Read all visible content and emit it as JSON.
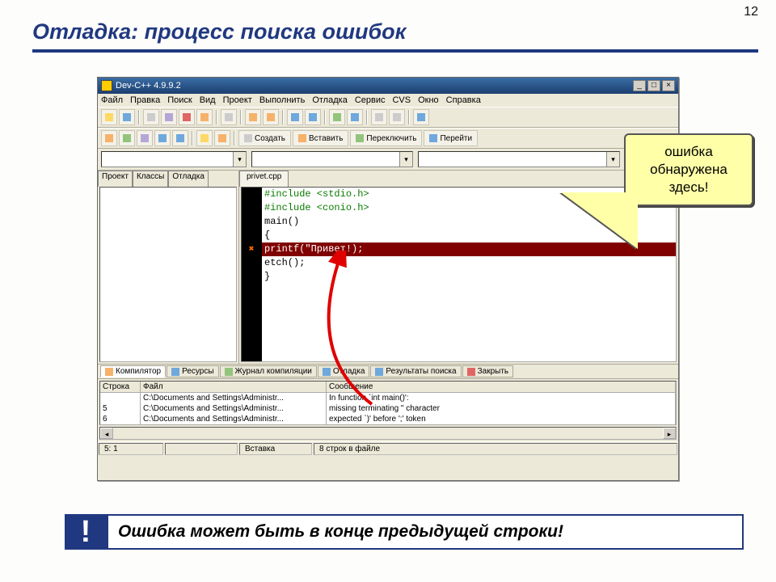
{
  "page_number": "12",
  "slide_title": "Отладка: процесс поиска ошибок",
  "window": {
    "title": "Dev-C++ 4.9.9.2",
    "window_controls": {
      "min": "_",
      "max": "□",
      "close": "×"
    }
  },
  "menu": [
    "Файл",
    "Правка",
    "Поиск",
    "Вид",
    "Проект",
    "Выполнить",
    "Отладка",
    "Сервис",
    "CVS",
    "Окно",
    "Справка"
  ],
  "toolbar2": {
    "create": "Создать",
    "insert": "Вставить",
    "switch": "Переключить",
    "goto": "Перейти"
  },
  "side_tabs": [
    "Проект",
    "Классы",
    "Отладка"
  ],
  "file_tab": "privet.cpp",
  "code": {
    "l1": "#include <stdio.h>",
    "l2": "#include <conio.h>",
    "l3": "main()",
    "l4": "{",
    "l5": "printf(\"Привет!);",
    "l6": "etch();",
    "l7": "}"
  },
  "bottom_tabs": {
    "compiler": "Компилятор",
    "resources": "Ресурсы",
    "log": "Журнал компиляции",
    "debug": "Отладка",
    "search": "Результаты поиска",
    "close": "Закрыть"
  },
  "error_table": {
    "headers": {
      "line": "Строка",
      "file": "Файл",
      "msg": "Сообщение"
    },
    "rows": [
      {
        "line": "",
        "file": "C:\\Documents and Settings\\Administr...",
        "msg": "In function `int main()':"
      },
      {
        "line": "5",
        "file": "C:\\Documents and Settings\\Administr...",
        "msg": "missing terminating \" character"
      },
      {
        "line": "6",
        "file": "C:\\Documents and Settings\\Administr...",
        "msg": "expected `)' before ';' token"
      }
    ]
  },
  "statusbar": {
    "pos": "5: 1",
    "mode": "Вставка",
    "lines": "8 строк в файле"
  },
  "callout": {
    "l1": "ошибка",
    "l2": "обнаружена",
    "l3": "здесь!"
  },
  "banner": {
    "ex": "!",
    "text": "Ошибка может быть в конце предыдущей строки!"
  }
}
